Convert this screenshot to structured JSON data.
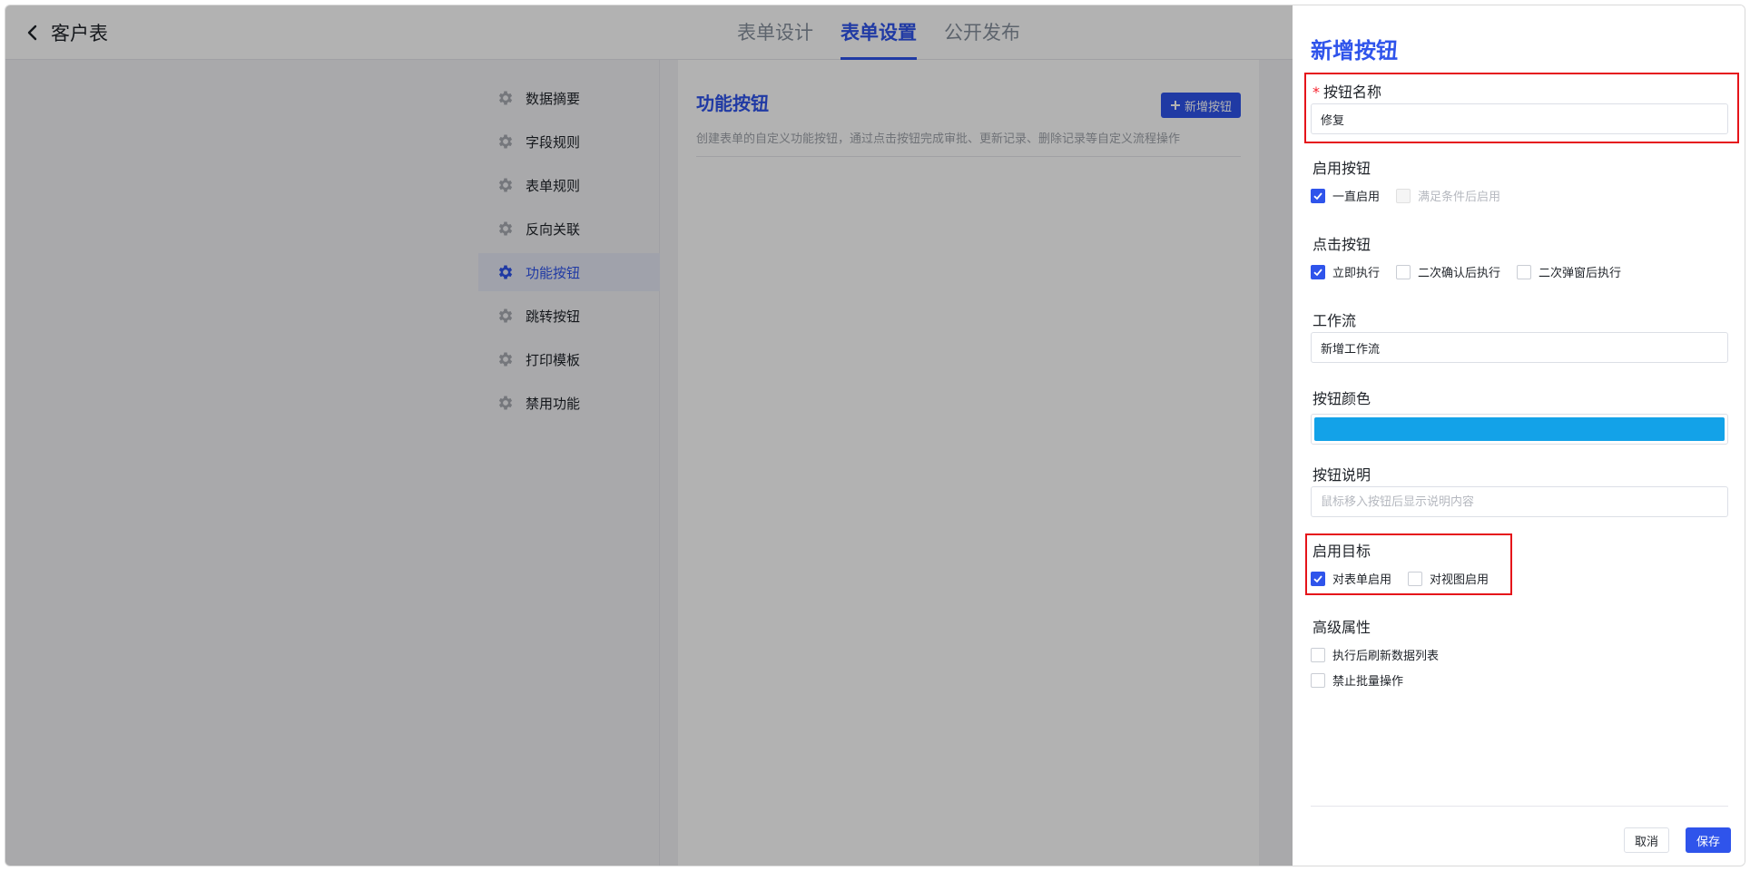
{
  "header": {
    "title": "客户表",
    "tabs": [
      {
        "label": "表单设计",
        "active": false
      },
      {
        "label": "表单设置",
        "active": true
      },
      {
        "label": "公开发布",
        "active": false
      }
    ]
  },
  "menu": {
    "items": [
      {
        "label": "数据摘要",
        "active": false
      },
      {
        "label": "字段规则",
        "active": false
      },
      {
        "label": "表单规则",
        "active": false
      },
      {
        "label": "反向关联",
        "active": false
      },
      {
        "label": "功能按钮",
        "active": true
      },
      {
        "label": "跳转按钮",
        "active": false
      },
      {
        "label": "打印模板",
        "active": false
      },
      {
        "label": "禁用功能",
        "active": false
      }
    ]
  },
  "content": {
    "title": "功能按钮",
    "add_button": "新增按钮",
    "description": "创建表单的自定义功能按钮，通过点击按钮完成审批、更新记录、删除记录等自定义流程操作"
  },
  "drawer": {
    "title": "新增按钮",
    "name_label": "按钮名称",
    "name_value": "修复",
    "enable_label": "启用按钮",
    "enable_options": [
      {
        "label": "一直启用",
        "checked": true,
        "disabled": false
      },
      {
        "label": "满足条件后启用",
        "checked": false,
        "disabled": true
      }
    ],
    "click_label": "点击按钮",
    "click_options": [
      {
        "label": "立即执行",
        "checked": true
      },
      {
        "label": "二次确认后执行",
        "checked": false
      },
      {
        "label": "二次弹窗后执行",
        "checked": false
      }
    ],
    "workflow_label": "工作流",
    "workflow_value": "新增工作流",
    "color_label": "按钮颜色",
    "color_value": "#13a2e8",
    "desc_label": "按钮说明",
    "desc_placeholder": "鼠标移入按钮后显示说明内容",
    "target_label": "启用目标",
    "target_options": [
      {
        "label": "对表单启用",
        "checked": true
      },
      {
        "label": "对视图启用",
        "checked": false
      }
    ],
    "advanced_label": "高级属性",
    "advanced_options": [
      {
        "label": "执行后刷新数据列表",
        "checked": false
      },
      {
        "label": "禁止批量操作",
        "checked": false
      }
    ],
    "cancel_label": "取消",
    "save_label": "保存"
  },
  "colors": {
    "accent": "#2f54eb",
    "highlight": "#e5141a"
  }
}
